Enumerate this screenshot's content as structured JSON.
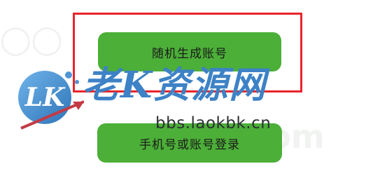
{
  "buttons": {
    "random_account_label": "随机生成账号",
    "phone_or_account_login_label": "手机号或账号登录"
  },
  "watermark": {
    "logo_text": "LK",
    "brand_text": "老K资源网",
    "url_text": "bbs.laokbk.cn"
  },
  "colors": {
    "button_green": "#4caf38",
    "highlight_red": "#e8252b",
    "brand_blue": "#3d82c6"
  }
}
